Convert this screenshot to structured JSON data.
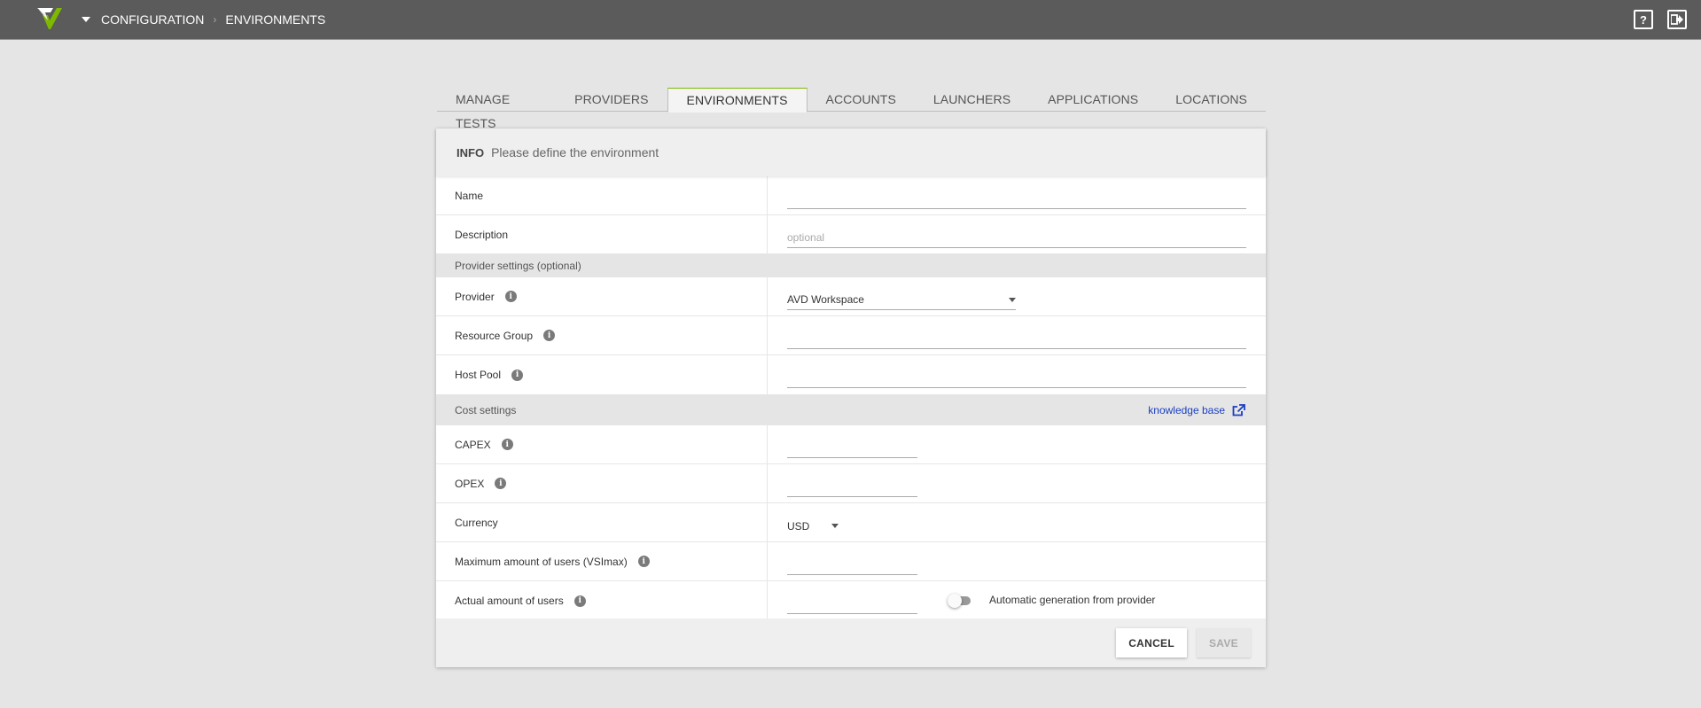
{
  "header": {
    "breadcrumbs": [
      "CONFIGURATION",
      "ENVIRONMENTS"
    ],
    "help_icon": "question-icon",
    "logout_icon": "logout-icon",
    "help_glyph": "?",
    "accent_color": "#7fb800"
  },
  "tabs": [
    {
      "label": "MANAGE TESTS",
      "active": false
    },
    {
      "label": "PROVIDERS",
      "active": false
    },
    {
      "label": "ENVIRONMENTS",
      "active": true
    },
    {
      "label": "ACCOUNTS",
      "active": false
    },
    {
      "label": "LAUNCHERS",
      "active": false
    },
    {
      "label": "APPLICATIONS",
      "active": false
    },
    {
      "label": "LOCATIONS",
      "active": false
    }
  ],
  "form": {
    "header_title": "INFO",
    "header_subtitle": "Please define the environment",
    "name_label": "Name",
    "name_value": "",
    "description_label": "Description",
    "description_placeholder": "optional",
    "provider_section": "Provider settings (optional)",
    "provider_label": "Provider",
    "provider_value": "AVD Workspace",
    "resource_group_label": "Resource Group",
    "resource_group_value": "",
    "host_pool_label": "Host Pool",
    "host_pool_value": "",
    "cost_section": "Cost settings",
    "knowledge_base_link": "knowledge base",
    "capex_label": "CAPEX",
    "opex_label": "OPEX",
    "currency_label": "Currency",
    "currency_value": "USD",
    "max_users_label": "Maximum amount of users (VSImax)",
    "actual_users_label": "Actual amount of users",
    "auto_generation_label": "Automatic generation from provider",
    "auto_generation_on": false,
    "info_glyph": "i"
  },
  "footer": {
    "cancel_label": "CANCEL",
    "save_label": "SAVE"
  }
}
